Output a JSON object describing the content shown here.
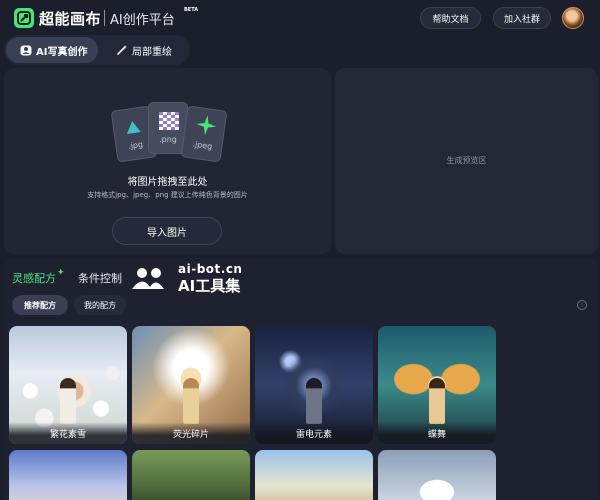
{
  "app": {
    "brand": "超能画布",
    "platform": "AI创作平台",
    "beta": "BETA"
  },
  "header": {
    "help_label": "帮助文档",
    "join_label": "加入社群"
  },
  "mode_tabs": [
    {
      "label": "AI写真创作",
      "active": true
    },
    {
      "label": "局部重绘",
      "active": false
    }
  ],
  "upload": {
    "file_types": [
      ".jpg",
      ".png",
      ".jpeg"
    ],
    "title": "将图片拖拽至此处",
    "hint": "支持格式jpg、jpeg、png 建议上传纯色背景的图片",
    "button_label": "导入图片"
  },
  "preview": {
    "label": "生成预览区"
  },
  "inspiration": {
    "tabs": [
      {
        "label": "灵感配方",
        "active": true
      },
      {
        "label": "条件控制",
        "active": false
      }
    ],
    "sub_tabs": [
      {
        "label": "推荐配方",
        "active": true
      },
      {
        "label": "我的配方",
        "active": false
      }
    ],
    "cards": [
      {
        "label": "繁花素雪"
      },
      {
        "label": "荧光碎片"
      },
      {
        "label": "雷电元素"
      },
      {
        "label": "蝶舞"
      }
    ]
  },
  "watermark": {
    "url": "ai-bot.cn",
    "name": "AI工具集"
  },
  "colors": {
    "accent": "#4be37c",
    "background": "#1b1f2c",
    "panel": "#222634"
  },
  "icons": {
    "logo": "brand-logo-icon",
    "camera": "portrait-camera-icon",
    "wand": "magic-wand-icon",
    "info": "info-icon"
  }
}
